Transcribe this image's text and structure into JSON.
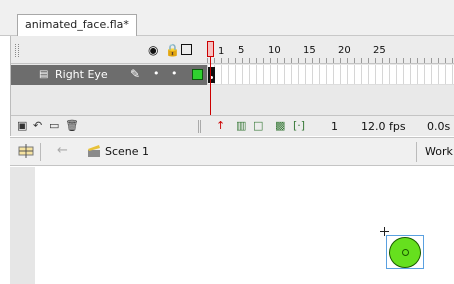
{
  "document": {
    "tab_label": "animated_face.fla*"
  },
  "timeline": {
    "header_icons": [
      "eye-icon",
      "lock-icon",
      "outline-square-icon"
    ],
    "ruler_labels": [
      "1",
      "5",
      "10",
      "15",
      "20",
      "25"
    ],
    "layer": {
      "name": "Right Eye",
      "icon": "layer-page-icon",
      "edit_icon": "pencil-icon",
      "visible_dot": "•",
      "lock_dot": "•",
      "color": "#2fd12f"
    },
    "footer": {
      "current_frame": "1",
      "frame_rate": "12.0 fps",
      "elapsed_time": "0.0s"
    }
  },
  "editbar": {
    "scene_label": "Scene 1",
    "workspace_label": "Work"
  },
  "stage": {
    "background": "#ffffff",
    "eye_fill": "#66e01e",
    "selection_color": "#5aa0e0"
  }
}
